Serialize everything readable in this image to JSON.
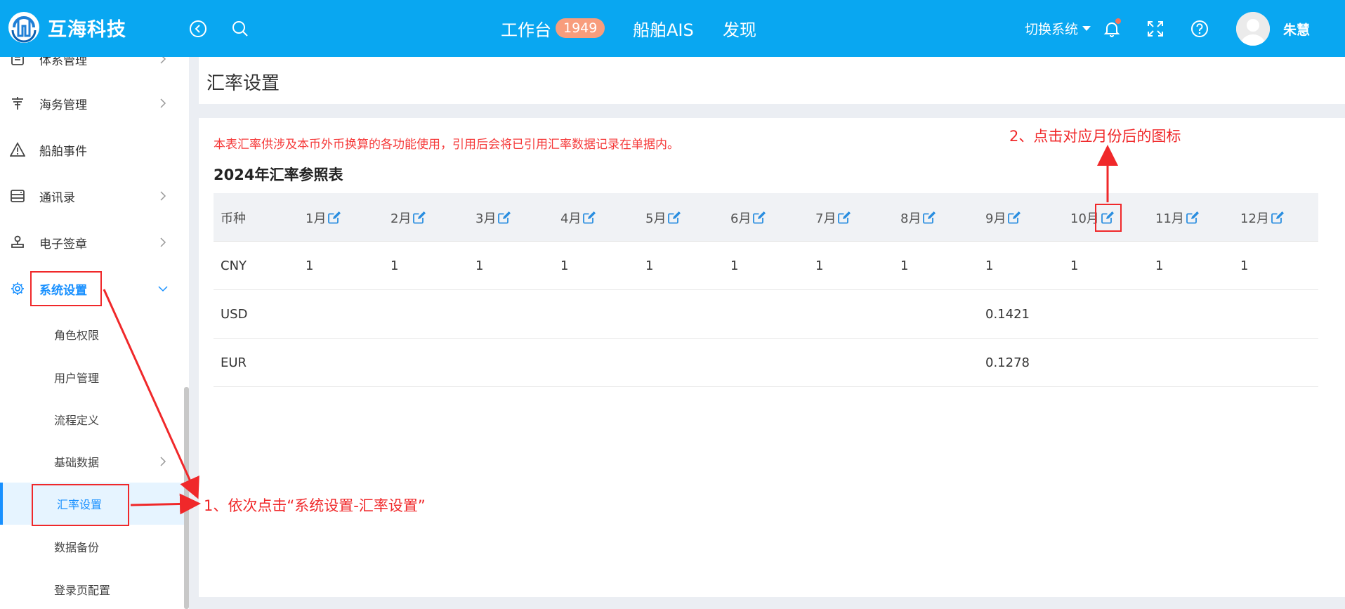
{
  "header": {
    "logo_text": "互海科技",
    "nav": [
      {
        "label": "工作台",
        "badge": "1949"
      },
      {
        "label": "船舶AIS"
      },
      {
        "label": "发现"
      }
    ],
    "switch_system": "切换系统",
    "user_name": "朱慧"
  },
  "sidebar": {
    "items": [
      {
        "label": "体系管理",
        "icon": "system-doc-icon"
      },
      {
        "label": "海务管理",
        "icon": "anchor-icon"
      },
      {
        "label": "船舶事件",
        "icon": "warning-icon"
      },
      {
        "label": "通讯录",
        "icon": "address-book-icon"
      },
      {
        "label": "电子签章",
        "icon": "stamp-icon"
      },
      {
        "label": "系统设置",
        "icon": "gear-icon",
        "active": true
      }
    ],
    "sub_items": [
      {
        "label": "角色权限"
      },
      {
        "label": "用户管理"
      },
      {
        "label": "流程定义"
      },
      {
        "label": "基础数据"
      },
      {
        "label": "汇率设置",
        "active": true
      },
      {
        "label": "数据备份"
      },
      {
        "label": "登录页配置"
      }
    ]
  },
  "page": {
    "title": "汇率设置",
    "notice": "本表汇率供涉及本币外币换算的各功能使用，引用后会将已引用汇率数据记录在单据内。",
    "table_title": "2024年汇率参照表",
    "columns": [
      "币种",
      "1月",
      "2月",
      "3月",
      "4月",
      "5月",
      "6月",
      "7月",
      "8月",
      "9月",
      "10月",
      "11月",
      "12月"
    ],
    "rows": [
      [
        "CNY",
        "1",
        "1",
        "1",
        "1",
        "1",
        "1",
        "1",
        "1",
        "1",
        "1",
        "1",
        "1"
      ],
      [
        "USD",
        "",
        "",
        "",
        "",
        "",
        "",
        "",
        "",
        "0.1421",
        "",
        "",
        ""
      ],
      [
        "EUR",
        "",
        "",
        "",
        "",
        "",
        "",
        "",
        "",
        "0.1278",
        "",
        "",
        ""
      ]
    ]
  },
  "annotations": {
    "step1": "1、依次点击“系统设置-汇率设置”",
    "step2": "2、点击对应月份后的图标"
  },
  "colors": {
    "header_bg": "#09a7f1",
    "accent": "#1890ff",
    "annotation_red": "#f0282a",
    "notice_red": "#f53a3a"
  }
}
